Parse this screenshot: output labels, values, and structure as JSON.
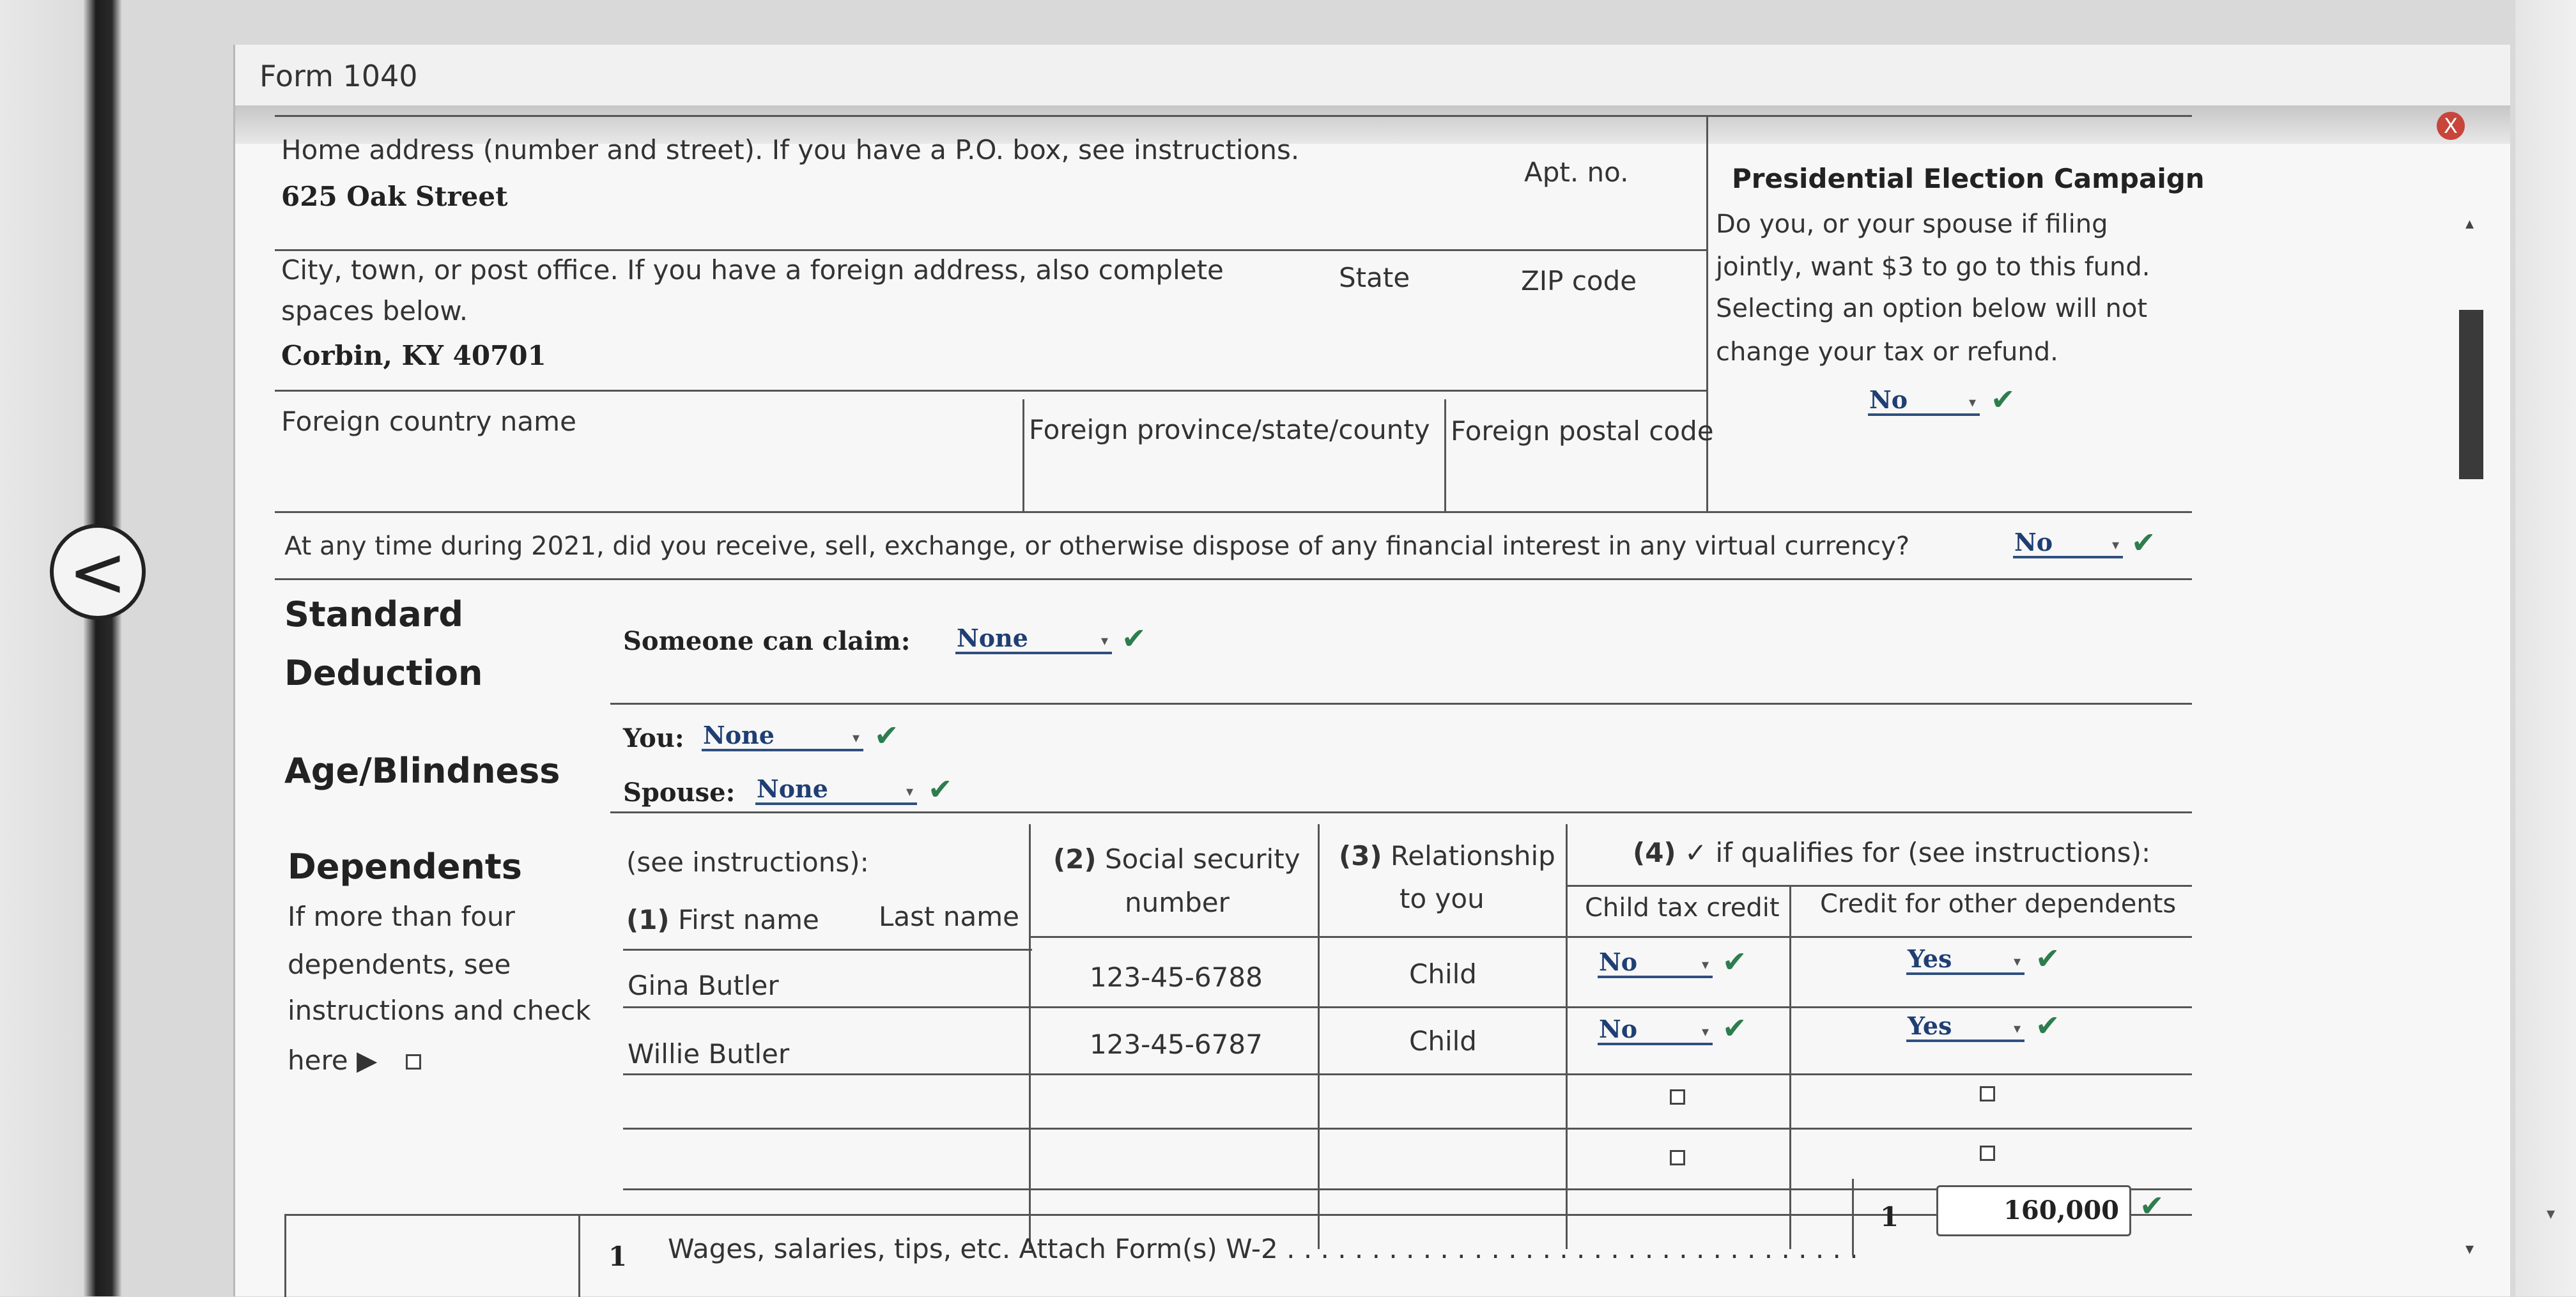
{
  "window": {
    "title": "Form 1040"
  },
  "address": {
    "home_label": "Home address (number and street). If you have a P.O. box, see instructions.",
    "home_value": "625 Oak Street",
    "apt_label": "Apt. no.",
    "city_label_1": "City, town, or post office. If you have a foreign address, also complete",
    "city_label_2": "spaces below.",
    "state_label": "State",
    "zip_label": "ZIP code",
    "city_value": "Corbin, KY 40701",
    "foreign_country_label": "Foreign country name",
    "foreign_province_label": "Foreign province/state/county",
    "foreign_postal_label": "Foreign postal code"
  },
  "campaign": {
    "title": "Presidential Election Campaign",
    "line1": "Do you, or your spouse if filing",
    "line2": "jointly, want $3 to go to this fund.",
    "line3": "Selecting an option below will not",
    "line4": "change your tax or refund.",
    "value": "No"
  },
  "virtual_currency": {
    "question": "At any time during 2021, did you receive, sell, exchange, or otherwise dispose of any financial interest in any virtual currency?",
    "value": "No"
  },
  "standard_deduction": {
    "heading_1": "Standard",
    "heading_2": "Deduction",
    "claim_label": "Someone can claim:",
    "claim_value": "None"
  },
  "age_blindness": {
    "heading": "Age/Blindness",
    "you_label": "You:",
    "you_value": "None",
    "spouse_label": "Spouse:",
    "spouse_value": "None"
  },
  "dependents": {
    "heading": "Dependents",
    "note_1": "If more than four",
    "note_2": "dependents, see",
    "note_3": "instructions and check",
    "note_4": "here ▶",
    "col_see": "(see instructions):",
    "col1_num": "(1)",
    "col1_first": "First name",
    "col1_last": "Last name",
    "col2_num": "(2)",
    "col2_a": "Social security",
    "col2_b": "number",
    "col3_num": "(3)",
    "col3_a": "Relationship",
    "col3_b": "to you",
    "col4_num": "(4)",
    "col4_text": "✓ if qualifies for (see instructions):",
    "col4_child": "Child tax credit",
    "col4_other": "Credit for other dependents",
    "rows": [
      {
        "name": "Gina Butler",
        "ssn": "123-45-6788",
        "relationship": "Child",
        "child_tax_credit": "No",
        "other_credit": "Yes"
      },
      {
        "name": "Willie Butler",
        "ssn": "123-45-6787",
        "relationship": "Child",
        "child_tax_credit": "No",
        "other_credit": "Yes"
      }
    ]
  },
  "line1": {
    "number": "1",
    "label": "Wages, salaries, tips, etc. Attach Form(s) W-2 . . . . . . . . . . . . . . . . . . . . . . . . . . . . . . . . . .",
    "box_number": "1",
    "value": "160,000"
  },
  "icons": {
    "check": "✔",
    "dropdown": "▾",
    "close": "X",
    "back": "<"
  }
}
